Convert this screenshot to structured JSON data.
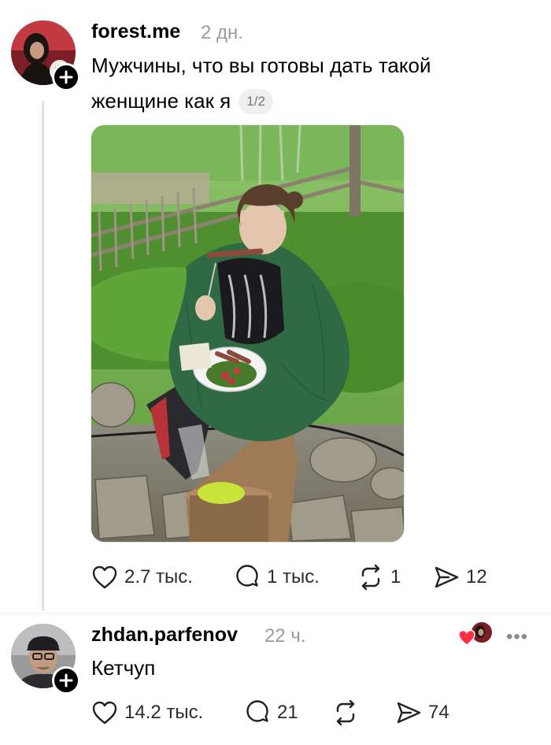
{
  "post": {
    "username": "forest.me",
    "time": "2 дн.",
    "text_line1": "Мужчины, что вы готовы дать такой",
    "text_line2": "женщине как я",
    "page_indicator": "1/2",
    "likes": "2.7 тыс.",
    "replies": "1 тыс.",
    "reposts": "1",
    "shares": "12"
  },
  "reply": {
    "username": "zhdan.parfenov",
    "time": "22 ч.",
    "text": "Кетчуп",
    "likes": "14.2 тыс.",
    "replies": "21",
    "reposts": "",
    "shares": "74",
    "more": "•••"
  },
  "icons": {
    "like": "heart-icon",
    "reply": "speech-bubble-icon",
    "repost": "repost-arrows-icon",
    "share": "paper-plane-icon",
    "follow": "plus-icon",
    "author_liked": "red-heart-icon"
  },
  "colors": {
    "text": "#000000",
    "secondary": "#9b9b9b",
    "like_red": "#ff3040",
    "divider": "#ececec"
  }
}
